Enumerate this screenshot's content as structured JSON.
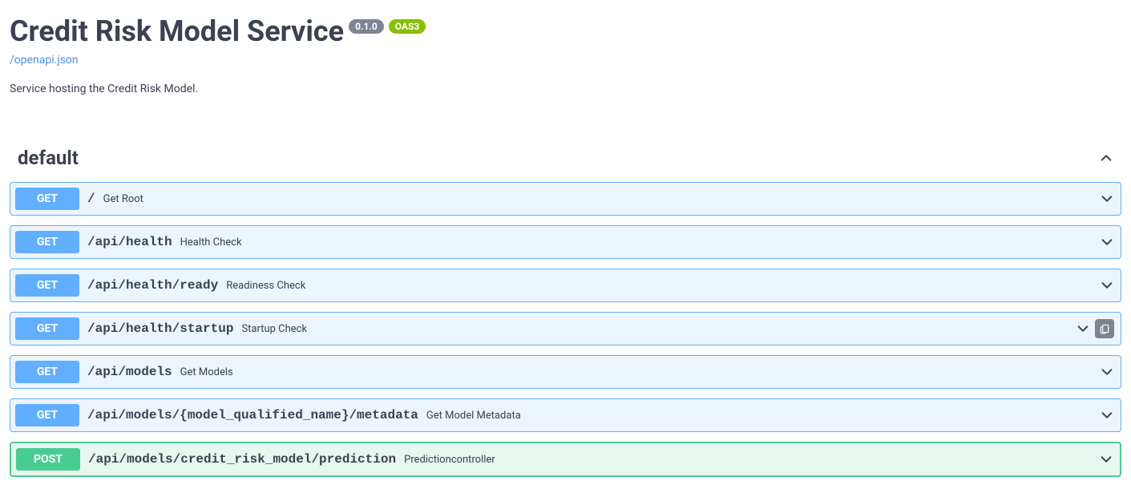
{
  "header": {
    "title": "Credit Risk Model Service",
    "version": "0.1.0",
    "oas": "OAS3",
    "spec_link": "/openapi.json",
    "description": "Service hosting the Credit Risk Model."
  },
  "tag": {
    "name": "default"
  },
  "operations": [
    {
      "method": "GET",
      "path": "/",
      "summary": "Get Root",
      "has_clipboard": false
    },
    {
      "method": "GET",
      "path": "/api/health",
      "summary": "Health Check",
      "has_clipboard": false
    },
    {
      "method": "GET",
      "path": "/api/health/ready",
      "summary": "Readiness Check",
      "has_clipboard": false
    },
    {
      "method": "GET",
      "path": "/api/health/startup",
      "summary": "Startup Check",
      "has_clipboard": true
    },
    {
      "method": "GET",
      "path": "/api/models",
      "summary": "Get Models",
      "has_clipboard": false
    },
    {
      "method": "GET",
      "path": "/api/models/{model_qualified_name}/metadata",
      "summary": "Get Model Metadata",
      "has_clipboard": false
    },
    {
      "method": "POST",
      "path": "/api/models/credit_risk_model/prediction",
      "summary": "Predictioncontroller",
      "has_clipboard": false
    }
  ],
  "colors": {
    "get": "#61affe",
    "post": "#49cc90",
    "oas_badge": "#89bf04",
    "version_badge": "#7d8492",
    "link": "#4990e2"
  }
}
